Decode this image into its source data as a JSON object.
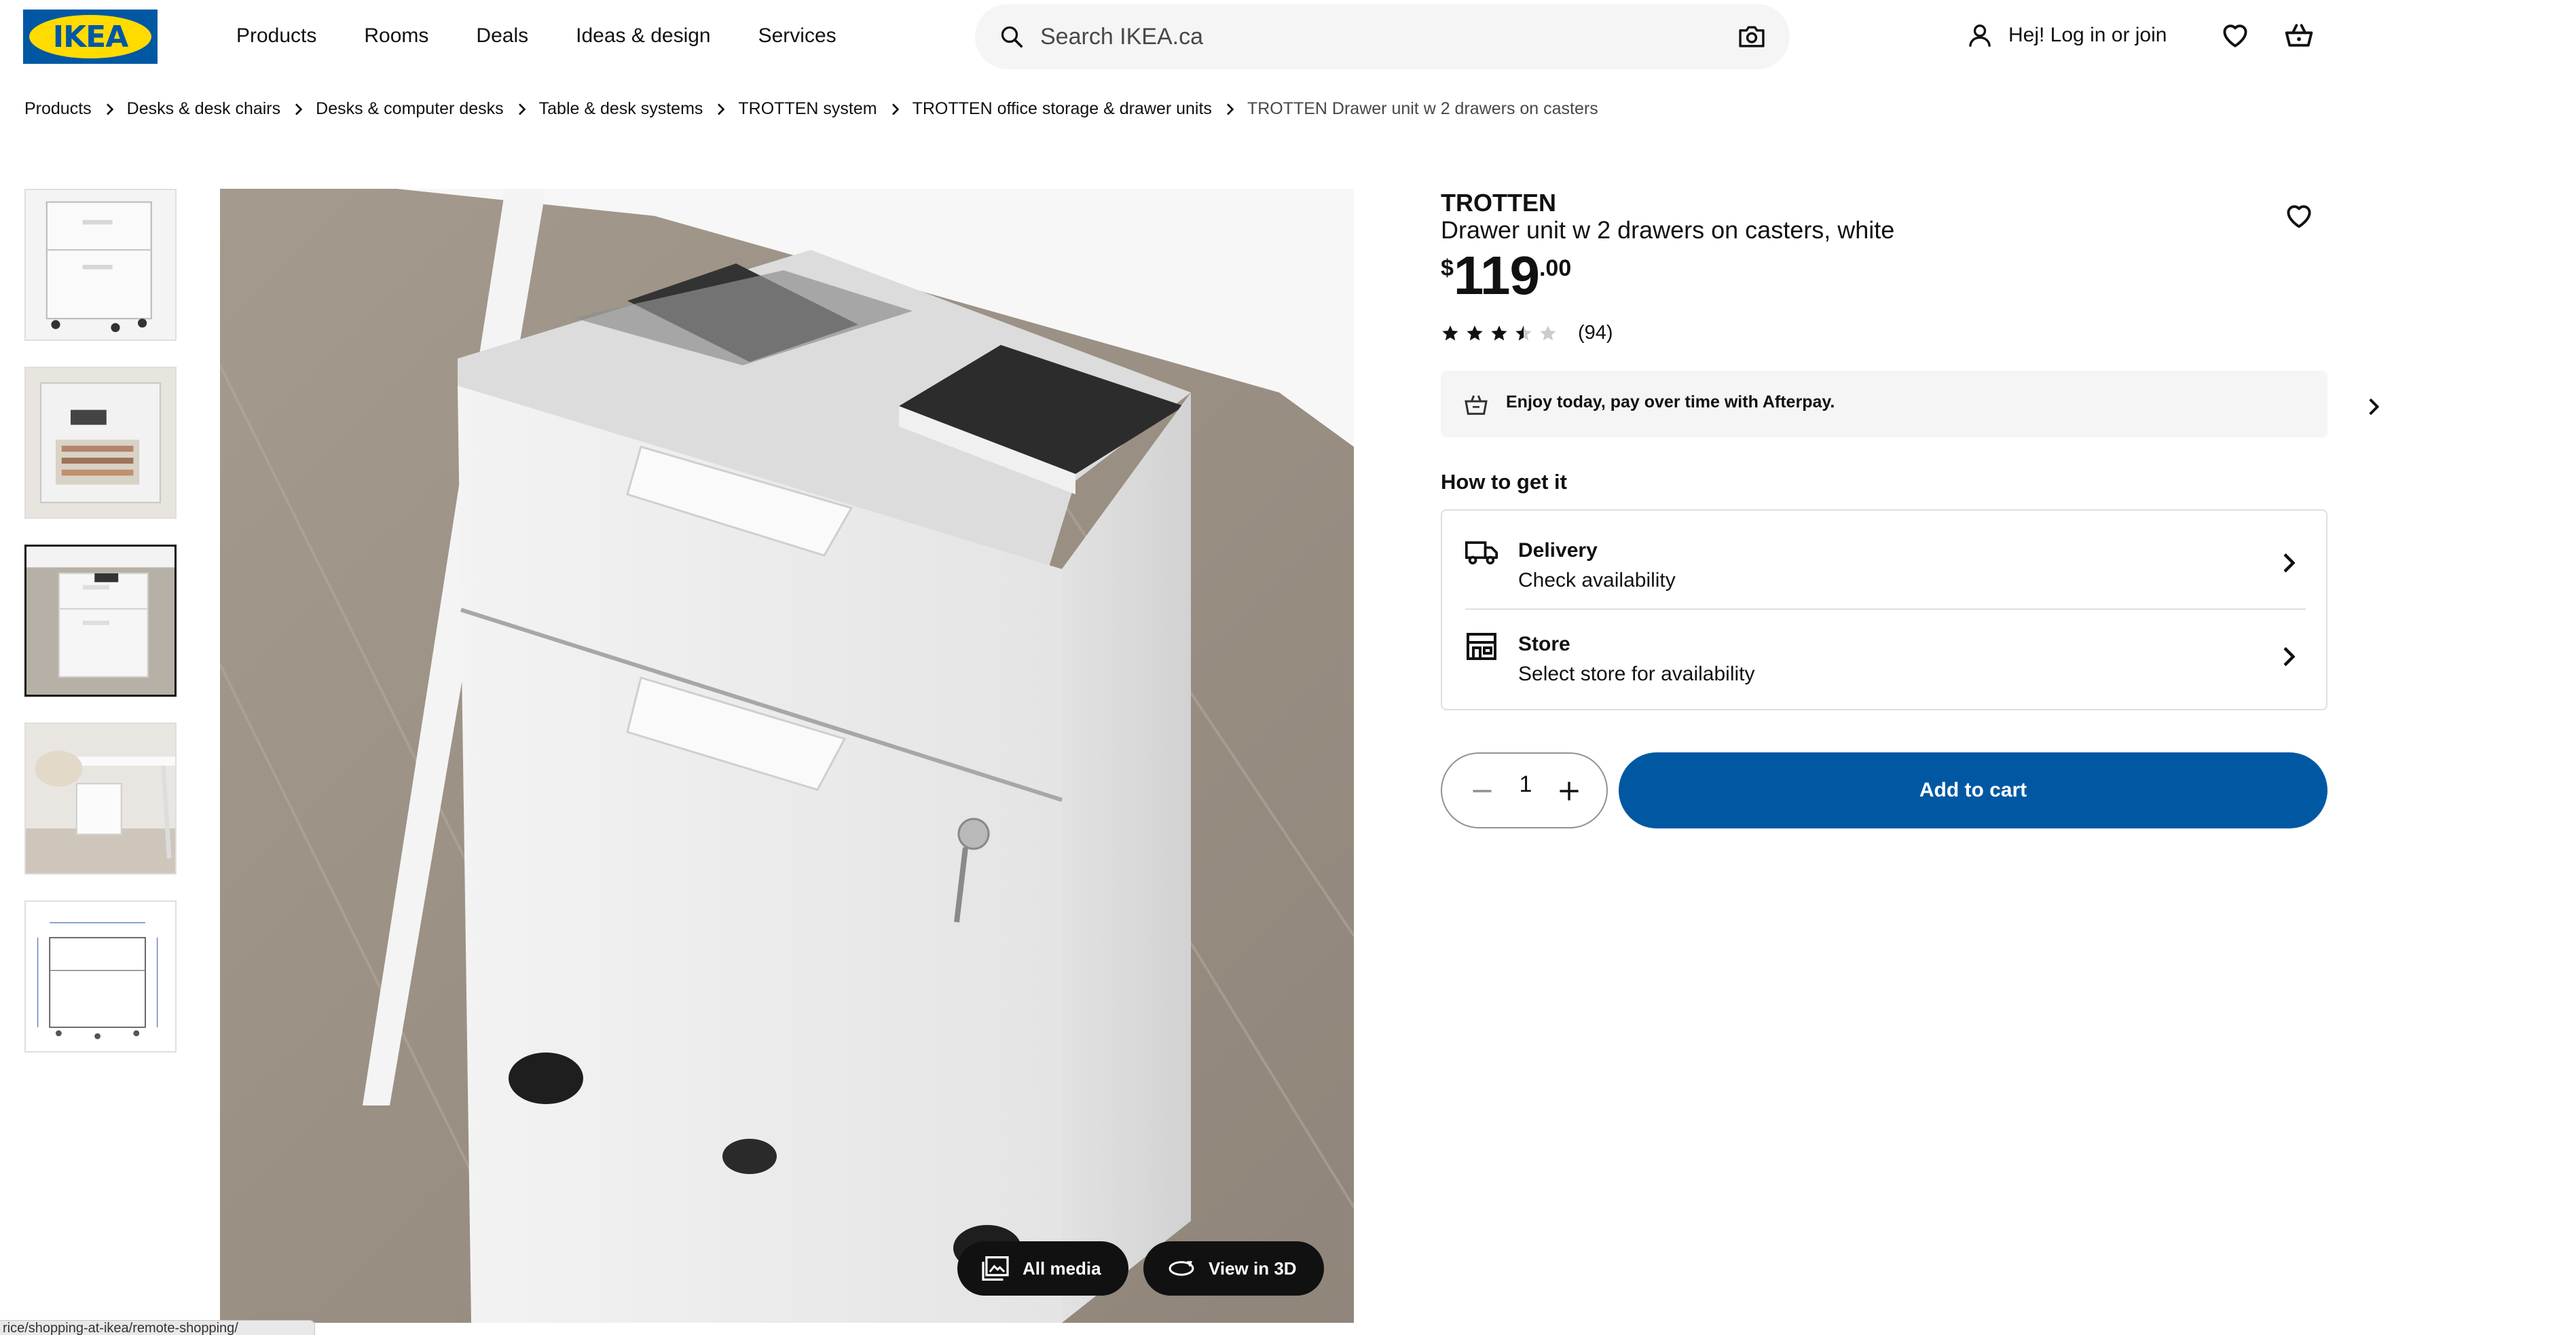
{
  "header": {
    "logo_text": "IKEA",
    "nav": [
      "Products",
      "Rooms",
      "Deals",
      "Ideas & design",
      "Services"
    ],
    "search_placeholder": "Search IKEA.ca",
    "account_label": "Hej! Log in or join"
  },
  "breadcrumbs": [
    "Products",
    "Desks & desk chairs",
    "Desks & computer desks",
    "Table & desk systems",
    "TROTTEN system",
    "TROTTEN office storage & drawer units",
    "TROTTEN Drawer unit w 2 drawers on casters"
  ],
  "gallery": {
    "thumbnail_count": 5,
    "active_thumbnail": 3,
    "all_media_label": "All media",
    "view_3d_label": "View in 3D"
  },
  "product": {
    "name": "TROTTEN",
    "description": "Drawer unit w 2 drawers on casters, white",
    "price_currency": "$",
    "price_integer": "119",
    "price_decimal": ".00",
    "rating_value": 3.5,
    "rating_max": 5,
    "review_count": "(94)"
  },
  "afterpay": {
    "text": "Enjoy today, pay over time with Afterpay."
  },
  "availability": {
    "title": "How to get it",
    "delivery_title": "Delivery",
    "delivery_sub": "Check availability",
    "store_title": "Store",
    "store_sub": "Select store for availability"
  },
  "cart": {
    "quantity": "1",
    "add_label": "Add to cart"
  },
  "status_bar": {
    "url_fragment": "rice/shopping-at-ikea/remote-shopping/"
  },
  "colors": {
    "brand_blue": "#0058a3",
    "brand_yellow": "#ffdb00",
    "text": "#111111",
    "light_bg": "#f5f5f5"
  }
}
